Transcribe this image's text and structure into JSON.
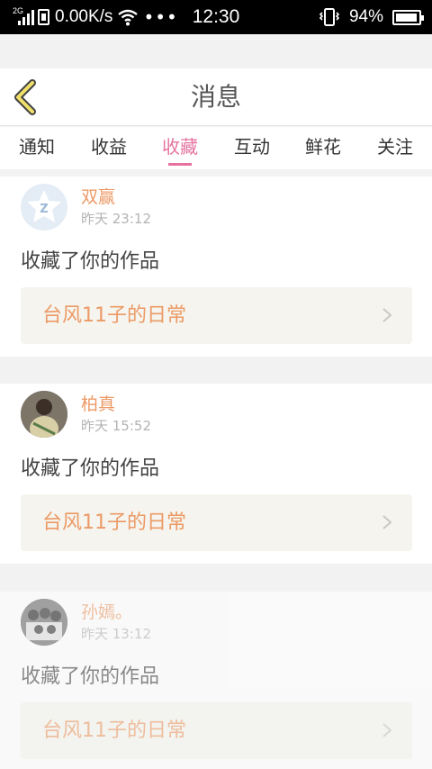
{
  "status_bar": {
    "network": "2G",
    "speed": "0.00K/s",
    "more": "•••",
    "time": "12:30",
    "battery": "94%",
    "battery_level": 0.94
  },
  "header": {
    "title": "消息",
    "back_icon": "chevron-left-icon"
  },
  "tabs": [
    {
      "label": "通知"
    },
    {
      "label": "收益"
    },
    {
      "label": "收藏",
      "active": true
    },
    {
      "label": "互动"
    },
    {
      "label": "鲜花"
    },
    {
      "label": "关注"
    }
  ],
  "colors": {
    "accent": "#e6739f",
    "name": "#ec9a66",
    "back_icon": "#f0e06a"
  },
  "messages": [
    {
      "name": "双赢",
      "time": "昨天 23:12",
      "action": "收藏了你的作品",
      "work": "台风11子的日常"
    },
    {
      "name": "柏真",
      "time": "昨天 15:52",
      "action": "收藏了你的作品",
      "work": "台风11子的日常"
    },
    {
      "name": "孙嫣。",
      "time": "昨天 13:12",
      "action": "收藏了你的作品",
      "work": "台风11子的日常"
    }
  ]
}
